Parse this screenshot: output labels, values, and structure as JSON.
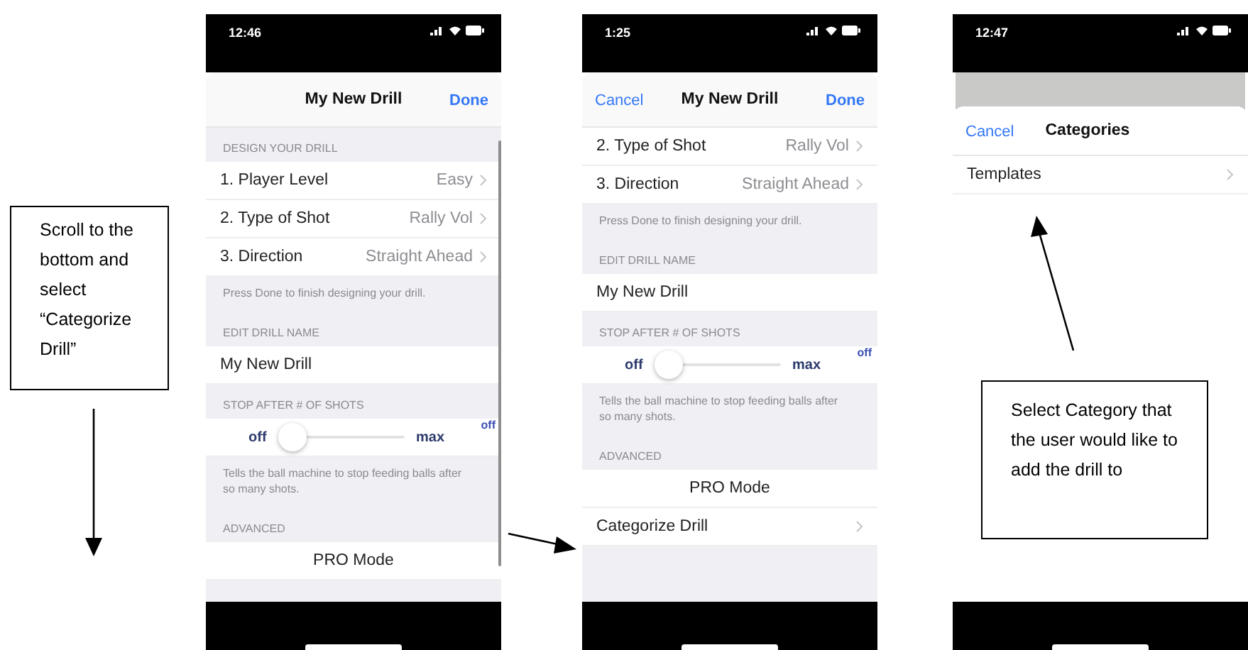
{
  "notes": [
    {
      "text": "Scroll to the bottom and select “Categorize Drill”"
    },
    {
      "text": "Select Category that the user would like to add the drill to"
    }
  ],
  "phones": [
    {
      "status_time": "12:46",
      "sheet_behind": false,
      "scroll_indicator": true,
      "nav": {
        "title": "My New Drill",
        "done": "Done"
      },
      "rows": [
        {
          "kind": "header",
          "text": "DESIGN YOUR DRILL"
        },
        {
          "kind": "link",
          "label": "1. Player Level",
          "value": "Easy"
        },
        {
          "kind": "link",
          "label": "2. Type of Shot",
          "value": "Rally Vol"
        },
        {
          "kind": "link",
          "label": "3. Direction",
          "value": "Straight Ahead"
        },
        {
          "kind": "footer",
          "text": "Press Done to finish designing your drill."
        },
        {
          "kind": "header",
          "text": "EDIT DRILL NAME"
        },
        {
          "kind": "text",
          "text": "My New Drill"
        },
        {
          "kind": "header",
          "text": "STOP AFTER # OF SHOTS"
        },
        {
          "kind": "slider",
          "min_label": "off",
          "max_label": "max",
          "level": 0,
          "reading": "off"
        },
        {
          "kind": "footer",
          "text": "Tells the ball machine to stop feeding balls after so many shots."
        },
        {
          "kind": "header",
          "text": "ADVANCED"
        },
        {
          "kind": "action",
          "text": "PRO Mode"
        }
      ]
    },
    {
      "status_time": "1:25",
      "sheet_behind": false,
      "scroll_indicator": false,
      "nav": {
        "cancel": "Cancel",
        "title": "My New Drill",
        "done": "Done"
      },
      "rows": [
        {
          "kind": "link",
          "label": "2. Type of Shot",
          "value": "Rally Vol"
        },
        {
          "kind": "link",
          "label": "3. Direction",
          "value": "Straight Ahead"
        },
        {
          "kind": "footer",
          "text": "Press Done to finish designing your drill."
        },
        {
          "kind": "header",
          "text": "EDIT DRILL NAME"
        },
        {
          "kind": "text",
          "text": "My New Drill"
        },
        {
          "kind": "header",
          "text": "STOP AFTER # OF SHOTS"
        },
        {
          "kind": "slider",
          "min_label": "off",
          "max_label": "max",
          "level": 0,
          "reading": "off"
        },
        {
          "kind": "footer",
          "text": "Tells the ball machine to stop feeding balls after so many shots."
        },
        {
          "kind": "header",
          "text": "ADVANCED"
        },
        {
          "kind": "action",
          "text": "PRO Mode"
        },
        {
          "kind": "link",
          "label": "Categorize Drill"
        }
      ]
    },
    {
      "status_time": "12:47",
      "sheet_behind": true,
      "scroll_indicator": false,
      "nav": {
        "cancel": "Cancel",
        "title": "Categories"
      },
      "rows": [
        {
          "kind": "link",
          "label": "Templates"
        }
      ]
    }
  ]
}
